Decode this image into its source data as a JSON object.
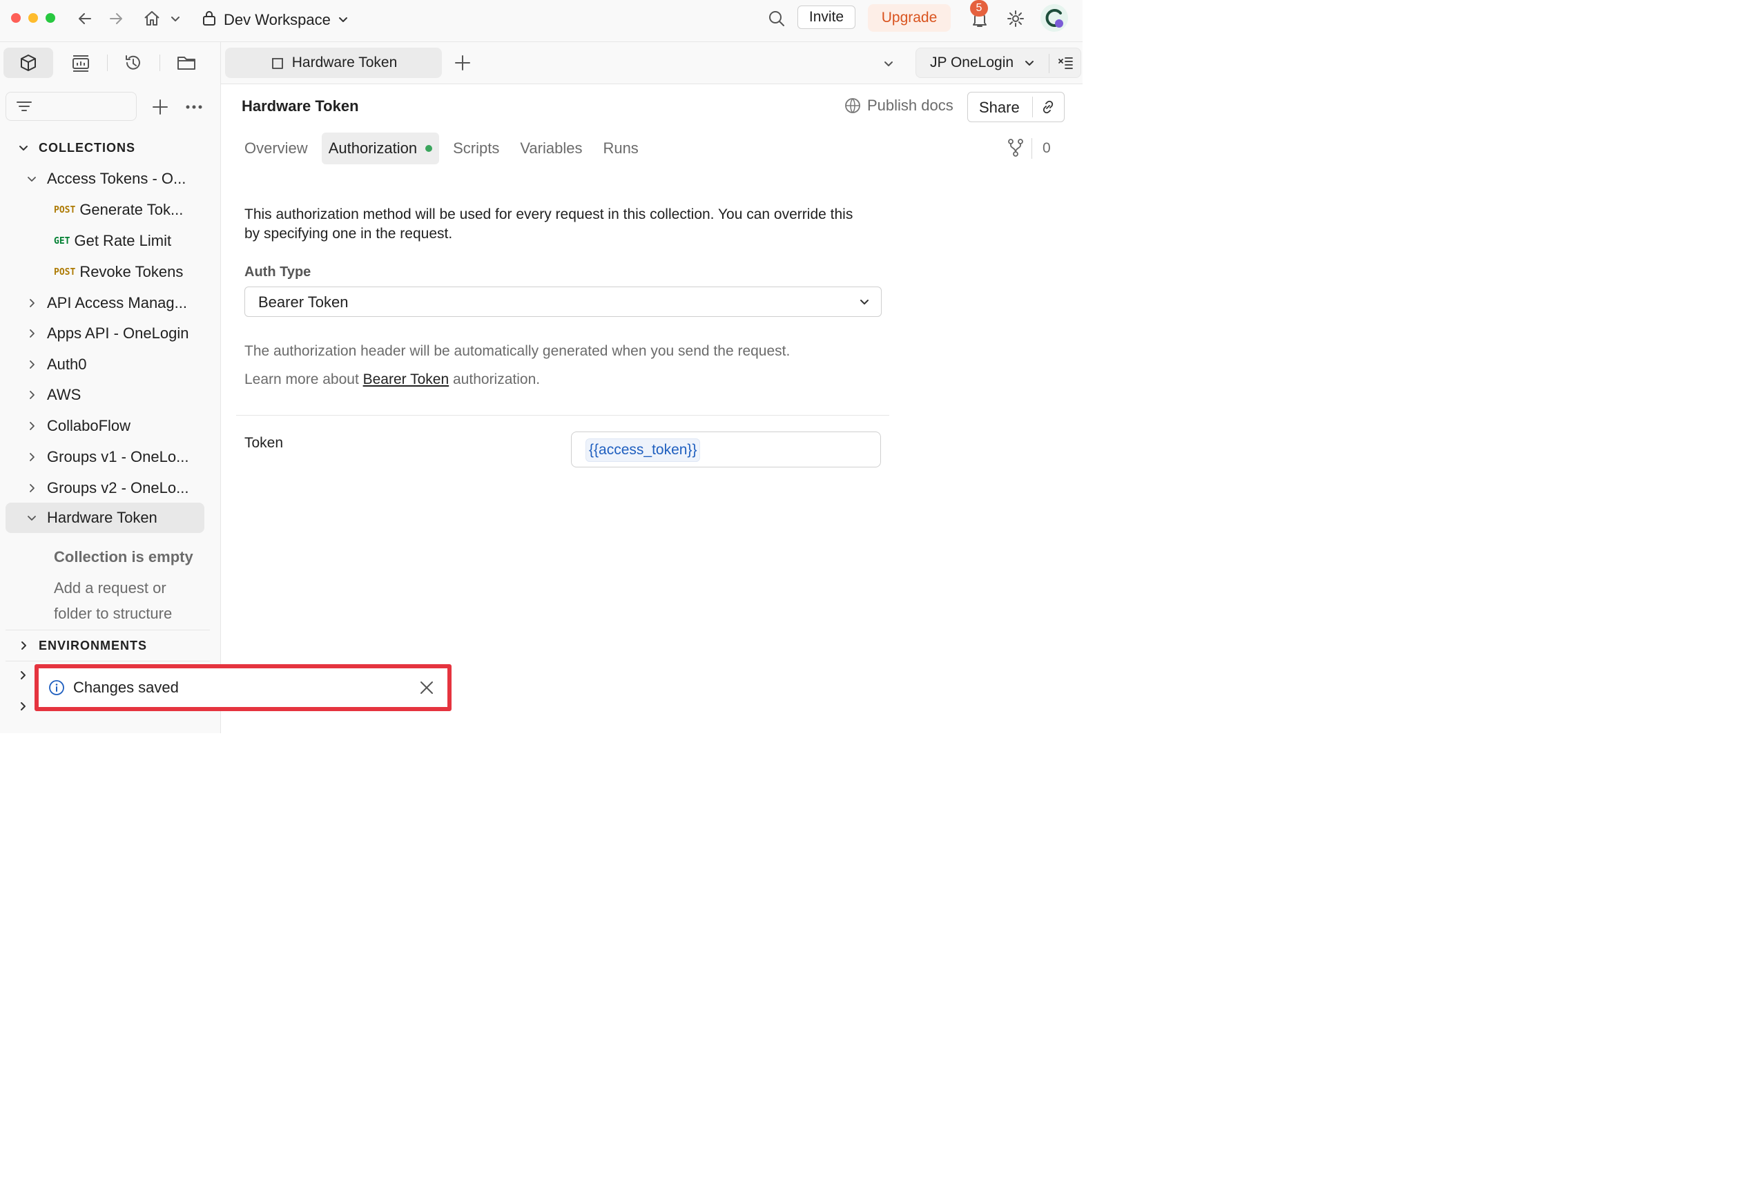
{
  "colors": {
    "accent_orange": "#d9531e",
    "badge": "#e5613e",
    "highlight_red": "#e5343f",
    "status_green": "#3aa55c",
    "var_blue": "#1f5fbf"
  },
  "topbar": {
    "workspace": "Dev Workspace",
    "invite_label": "Invite",
    "upgrade_label": "Upgrade",
    "notification_count": "5",
    "icons": [
      "back-arrow-icon",
      "forward-arrow-icon",
      "home-icon",
      "chevron-down-icon",
      "lock-icon",
      "search-icon",
      "bell-icon",
      "gear-icon",
      "avatar"
    ]
  },
  "sidebar": {
    "collections_label": "COLLECTIONS",
    "items": [
      {
        "label": "Access Tokens - O...",
        "expanded": true
      },
      {
        "method": "POST",
        "label": "Generate Tok..."
      },
      {
        "method": "GET",
        "label": "Get Rate Limit"
      },
      {
        "method": "POST",
        "label": "Revoke Tokens"
      },
      {
        "label": "API Access Manag..."
      },
      {
        "label": "Apps API - OneLogin"
      },
      {
        "label": "Auth0"
      },
      {
        "label": "AWS"
      },
      {
        "label": "CollaboFlow"
      },
      {
        "label": "Groups v1 - OneLo..."
      },
      {
        "label": "Groups v2 - OneLo..."
      },
      {
        "label": "Hardware Token",
        "expanded": true,
        "selected": true
      }
    ],
    "empty_title": "Collection is empty",
    "empty_text": "Add a request or folder to structure",
    "environments_label": "ENVIRONMENTS"
  },
  "tabstrip": {
    "active_tab": "Hardware Token",
    "environment": "JP OneLogin"
  },
  "main": {
    "title": "Hardware Token",
    "publish_label": "Publish docs",
    "share_label": "Share",
    "tabs": [
      {
        "label": "Overview"
      },
      {
        "label": "Authorization",
        "active": true
      },
      {
        "label": "Scripts"
      },
      {
        "label": "Variables"
      },
      {
        "label": "Runs"
      }
    ],
    "fork_count": "0",
    "description": "This authorization method will be used for every request in this collection. You can override this by specifying one in the request.",
    "auth_type_label": "Auth Type",
    "auth_type_value": "Bearer Token",
    "help_line1": "The authorization header will be automatically generated when you send the request.",
    "help_learn_prefix": "Learn more about",
    "help_link": "Bearer Token",
    "help_learn_suffix": "authorization.",
    "token_label": "Token",
    "token_value": "{{access_token}}"
  },
  "toast": {
    "message": "Changes saved"
  }
}
